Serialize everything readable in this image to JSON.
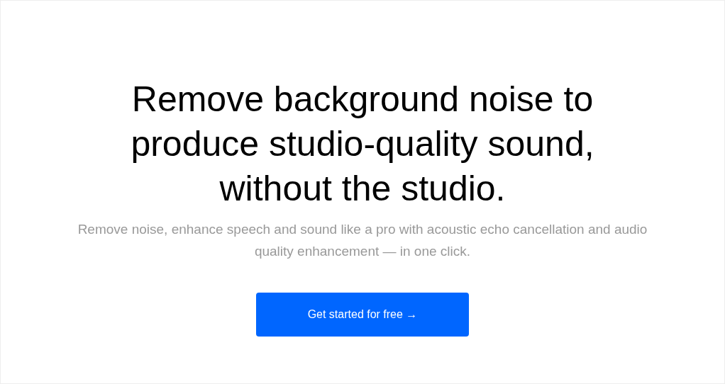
{
  "hero": {
    "headline": "Remove background noise to produce studio-quality sound, without the studio.",
    "subheadline": "Remove noise, enhance speech and sound like a pro with acoustic echo cancellation and audio quality enhancement — in one click.",
    "cta_button": "Get started for free →"
  }
}
